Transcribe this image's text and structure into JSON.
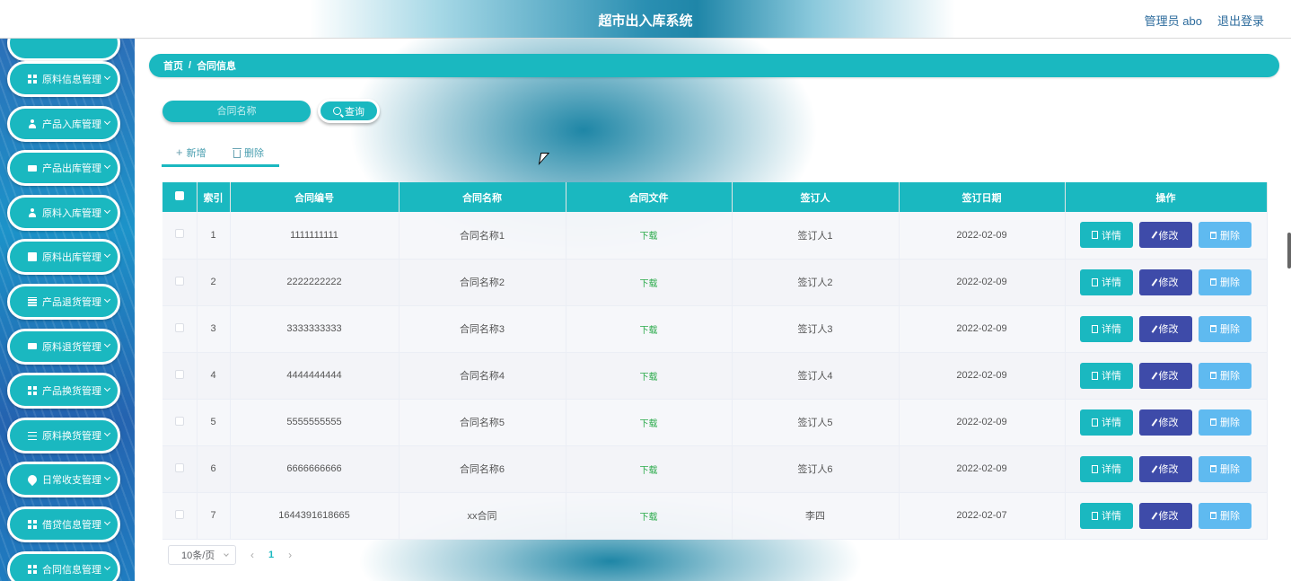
{
  "header": {
    "title": "超市出入库系统",
    "user": "管理员 abo",
    "logout": "退出登录"
  },
  "sidebar": {
    "items": [
      {
        "label": "原料信息管理",
        "icon": "grid-icon"
      },
      {
        "label": "产品入库管理",
        "icon": "user-icon"
      },
      {
        "label": "产品出库管理",
        "icon": "ticket-icon"
      },
      {
        "label": "原料入库管理",
        "icon": "user-icon"
      },
      {
        "label": "原料出库管理",
        "icon": "clipboard-icon"
      },
      {
        "label": "产品退货管理",
        "icon": "table-icon"
      },
      {
        "label": "原料退货管理",
        "icon": "monitor-icon"
      },
      {
        "label": "产品换货管理",
        "icon": "grid-icon"
      },
      {
        "label": "原料换货管理",
        "icon": "list-icon"
      },
      {
        "label": "日常收支管理",
        "icon": "location-icon"
      },
      {
        "label": "借贷信息管理",
        "icon": "grid-icon"
      },
      {
        "label": "合同信息管理",
        "icon": "grid-icon"
      }
    ]
  },
  "breadcrumb": {
    "home": "首页",
    "separator": "/",
    "current": "合同信息"
  },
  "search": {
    "placeholder": "合同名称",
    "button": "查询"
  },
  "actions": {
    "add": "新增",
    "delete": "删除"
  },
  "table": {
    "columns": [
      "索引",
      "合同编号",
      "合同名称",
      "合同文件",
      "签订人",
      "签订日期",
      "操作"
    ],
    "rows": [
      {
        "index": "1",
        "number": "1111111111",
        "name": "合同名称1",
        "file": "下载",
        "signer": "签订人1",
        "date": "2022-02-09"
      },
      {
        "index": "2",
        "number": "2222222222",
        "name": "合同名称2",
        "file": "下载",
        "signer": "签订人2",
        "date": "2022-02-09"
      },
      {
        "index": "3",
        "number": "3333333333",
        "name": "合同名称3",
        "file": "下载",
        "signer": "签订人3",
        "date": "2022-02-09"
      },
      {
        "index": "4",
        "number": "4444444444",
        "name": "合同名称4",
        "file": "下载",
        "signer": "签订人4",
        "date": "2022-02-09"
      },
      {
        "index": "5",
        "number": "5555555555",
        "name": "合同名称5",
        "file": "下载",
        "signer": "签订人5",
        "date": "2022-02-09"
      },
      {
        "index": "6",
        "number": "6666666666",
        "name": "合同名称6",
        "file": "下载",
        "signer": "签订人6",
        "date": "2022-02-09"
      },
      {
        "index": "7",
        "number": "1644391618665",
        "name": "xx合同",
        "file": "下载",
        "signer": "李四",
        "date": "2022-02-07"
      }
    ],
    "row_actions": {
      "detail": "详情",
      "edit": "修改",
      "delete": "删除"
    }
  },
  "pagination": {
    "page_size": "10条/页",
    "current_page": "1"
  },
  "colors": {
    "primary": "#1ab8c0",
    "edit": "#3e4ba9",
    "delete": "#5fbaf0",
    "download": "#2aaa4a"
  }
}
